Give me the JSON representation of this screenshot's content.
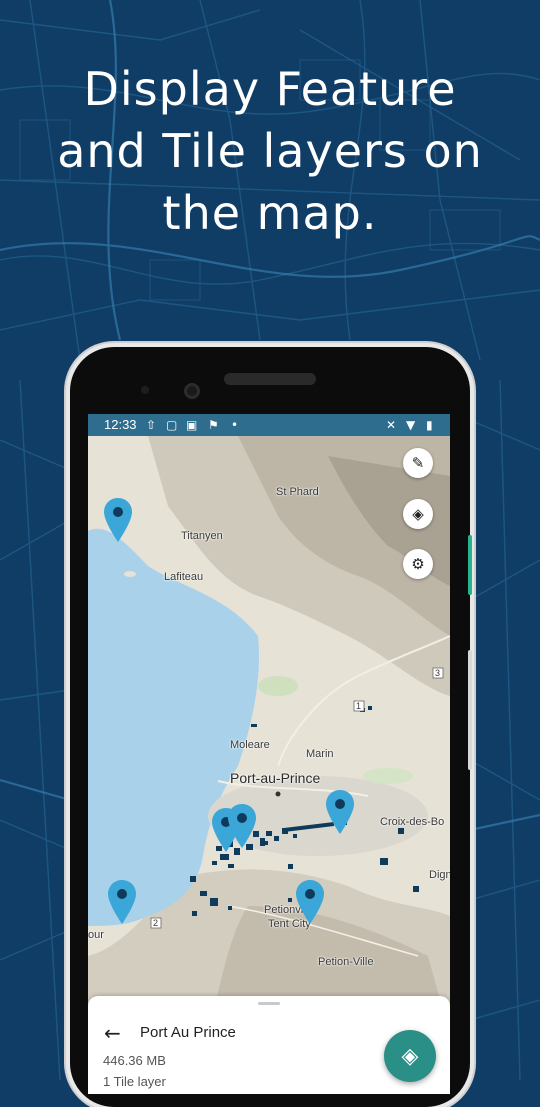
{
  "headline": {
    "line1": "Display Feature",
    "line2": "and Tile layers on",
    "line3": "the map."
  },
  "status_bar": {
    "time": "12:33",
    "icons_left": [
      "upload-icon",
      "lock-icon",
      "gallery-icon",
      "flag-icon",
      "dot-icon"
    ],
    "icons_right": [
      "no-sound-icon",
      "wifi-icon",
      "battery-icon"
    ]
  },
  "map": {
    "places": {
      "st_phard": "St Phard",
      "titanyen": "Titanyen",
      "lafiteau": "Lafiteau",
      "moleare": "Moleare",
      "marin": "Marin",
      "port_au_prince": "Port-au-Prince",
      "croix_des_bo": "Croix-des-Bo",
      "digne": "Digne",
      "petionville_tent_city_1": "Petionville",
      "petionville_tent_city_2": "Tent City",
      "petion_ville": "Petion-Ville",
      "carrefour_partial": "our"
    },
    "road_shields": {
      "r1": "1",
      "r2": "2",
      "r3": "3"
    },
    "buttons": {
      "edit": "edit-icon",
      "layers": "layers-icon",
      "settings": "gear-icon"
    }
  },
  "sheet": {
    "title": "Port Au Prince",
    "size": "446.36 MB",
    "layers": "1 Tile layer"
  },
  "colors": {
    "background": "#0f3d66",
    "status_bar": "#2f6d8f",
    "pin": "#3aa7d8",
    "feature": "#0e3a5c",
    "fab": "#2a8f86"
  }
}
